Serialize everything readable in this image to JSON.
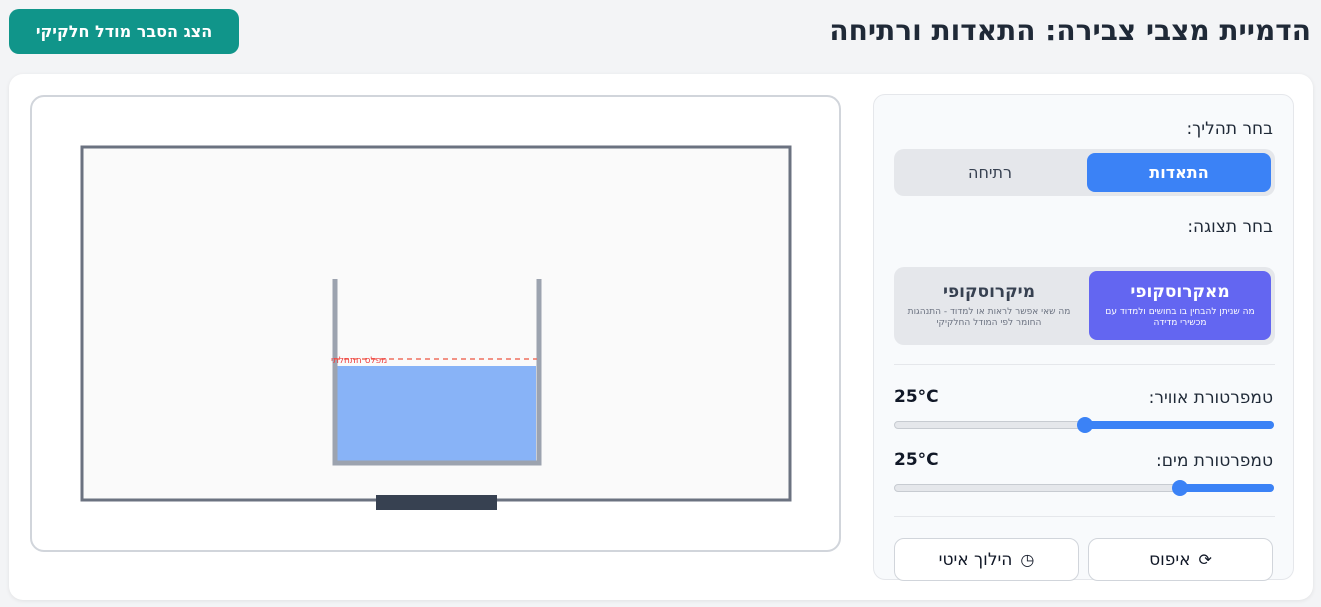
{
  "header": {
    "title": "הדמיית מצבי צבירה: התאדות ורתיחה",
    "explain_button": "הצג הסבר מודל חלקיקי"
  },
  "simulation": {
    "initial_level_label": "מפלס התחלתי"
  },
  "controls": {
    "process_label": "בחר תהליך:",
    "process_options": [
      {
        "label": "התאדות",
        "active": true
      },
      {
        "label": "רתיחה",
        "active": false
      }
    ],
    "view_label": "בחר תצוגה:",
    "view_options": [
      {
        "title": "מאקרוסקופי",
        "description": "מה שניתן להבחין בו בחושים ולמדוד עם מכשירי מדידה",
        "active": true
      },
      {
        "title": "מיקרוסקופי",
        "description": "מה שאי אפשר לראות או למדוד - התנהגות החומר לפי המודל החלקיקי",
        "active": false
      }
    ],
    "air_temp": {
      "label": "טמפרטורת אוויר:",
      "value": "25°C",
      "level": 0.5
    },
    "water_temp": {
      "label": "טמפרטורת מים:",
      "value": "25°C",
      "level": 0.25
    },
    "reset_button": "איפוס",
    "reset_icon": "refresh-icon",
    "time_lapse_button": "הילוך איטי",
    "time_lapse_icon": "clock-icon"
  },
  "colors": {
    "accent_blue": "#3b82f6",
    "accent_indigo": "#6366f1",
    "teal": "#10958a",
    "water": "#88b3f7",
    "level_line": "#ef6f5e"
  }
}
